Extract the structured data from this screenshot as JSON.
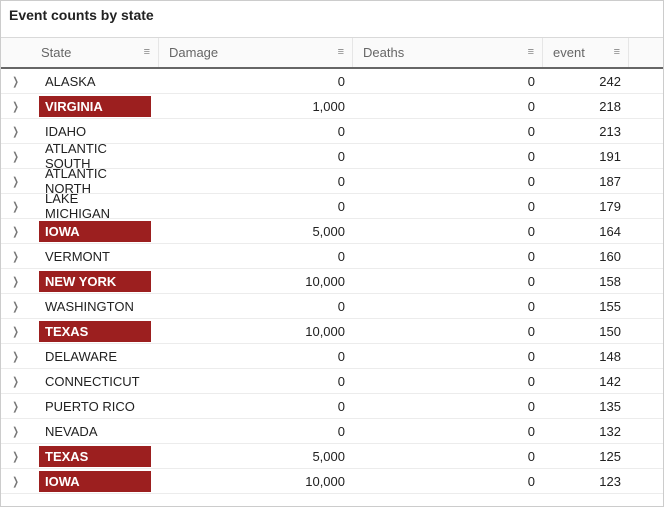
{
  "title": "Event counts by state",
  "columns": {
    "state": "State",
    "damage": "Damage",
    "deaths": "Deaths",
    "event": "event"
  },
  "highlight_color": "#9c1f1f",
  "rows": [
    {
      "state": "ALASKA",
      "damage": "0",
      "deaths": "0",
      "event": "242",
      "highlight": false
    },
    {
      "state": "VIRGINIA",
      "damage": "1,000",
      "deaths": "0",
      "event": "218",
      "highlight": true
    },
    {
      "state": "IDAHO",
      "damage": "0",
      "deaths": "0",
      "event": "213",
      "highlight": false
    },
    {
      "state": "ATLANTIC SOUTH",
      "damage": "0",
      "deaths": "0",
      "event": "191",
      "highlight": false
    },
    {
      "state": "ATLANTIC NORTH",
      "damage": "0",
      "deaths": "0",
      "event": "187",
      "highlight": false
    },
    {
      "state": "LAKE MICHIGAN",
      "damage": "0",
      "deaths": "0",
      "event": "179",
      "highlight": false
    },
    {
      "state": "IOWA",
      "damage": "5,000",
      "deaths": "0",
      "event": "164",
      "highlight": true
    },
    {
      "state": "VERMONT",
      "damage": "0",
      "deaths": "0",
      "event": "160",
      "highlight": false
    },
    {
      "state": "NEW YORK",
      "damage": "10,000",
      "deaths": "0",
      "event": "158",
      "highlight": true
    },
    {
      "state": "WASHINGTON",
      "damage": "0",
      "deaths": "0",
      "event": "155",
      "highlight": false
    },
    {
      "state": "TEXAS",
      "damage": "10,000",
      "deaths": "0",
      "event": "150",
      "highlight": true
    },
    {
      "state": "DELAWARE",
      "damage": "0",
      "deaths": "0",
      "event": "148",
      "highlight": false
    },
    {
      "state": "CONNECTICUT",
      "damage": "0",
      "deaths": "0",
      "event": "142",
      "highlight": false
    },
    {
      "state": "PUERTO RICO",
      "damage": "0",
      "deaths": "0",
      "event": "135",
      "highlight": false
    },
    {
      "state": "NEVADA",
      "damage": "0",
      "deaths": "0",
      "event": "132",
      "highlight": false
    },
    {
      "state": "TEXAS",
      "damage": "5,000",
      "deaths": "0",
      "event": "125",
      "highlight": true
    },
    {
      "state": "IOWA",
      "damage": "10,000",
      "deaths": "0",
      "event": "123",
      "highlight": true
    }
  ],
  "chart_data": {
    "type": "table",
    "title": "Event counts by state",
    "columns": [
      "State",
      "Damage",
      "Deaths",
      "event"
    ],
    "rows": [
      [
        "ALASKA",
        0,
        0,
        242
      ],
      [
        "VIRGINIA",
        1000,
        0,
        218
      ],
      [
        "IDAHO",
        0,
        0,
        213
      ],
      [
        "ATLANTIC SOUTH",
        0,
        0,
        191
      ],
      [
        "ATLANTIC NORTH",
        0,
        0,
        187
      ],
      [
        "LAKE MICHIGAN",
        0,
        0,
        179
      ],
      [
        "IOWA",
        5000,
        0,
        164
      ],
      [
        "VERMONT",
        0,
        0,
        160
      ],
      [
        "NEW YORK",
        10000,
        0,
        158
      ],
      [
        "WASHINGTON",
        0,
        0,
        155
      ],
      [
        "TEXAS",
        10000,
        0,
        150
      ],
      [
        "DELAWARE",
        0,
        0,
        148
      ],
      [
        "CONNECTICUT",
        0,
        0,
        142
      ],
      [
        "PUERTO RICO",
        0,
        0,
        135
      ],
      [
        "NEVADA",
        0,
        0,
        132
      ],
      [
        "TEXAS",
        5000,
        0,
        125
      ],
      [
        "IOWA",
        10000,
        0,
        123
      ]
    ]
  }
}
